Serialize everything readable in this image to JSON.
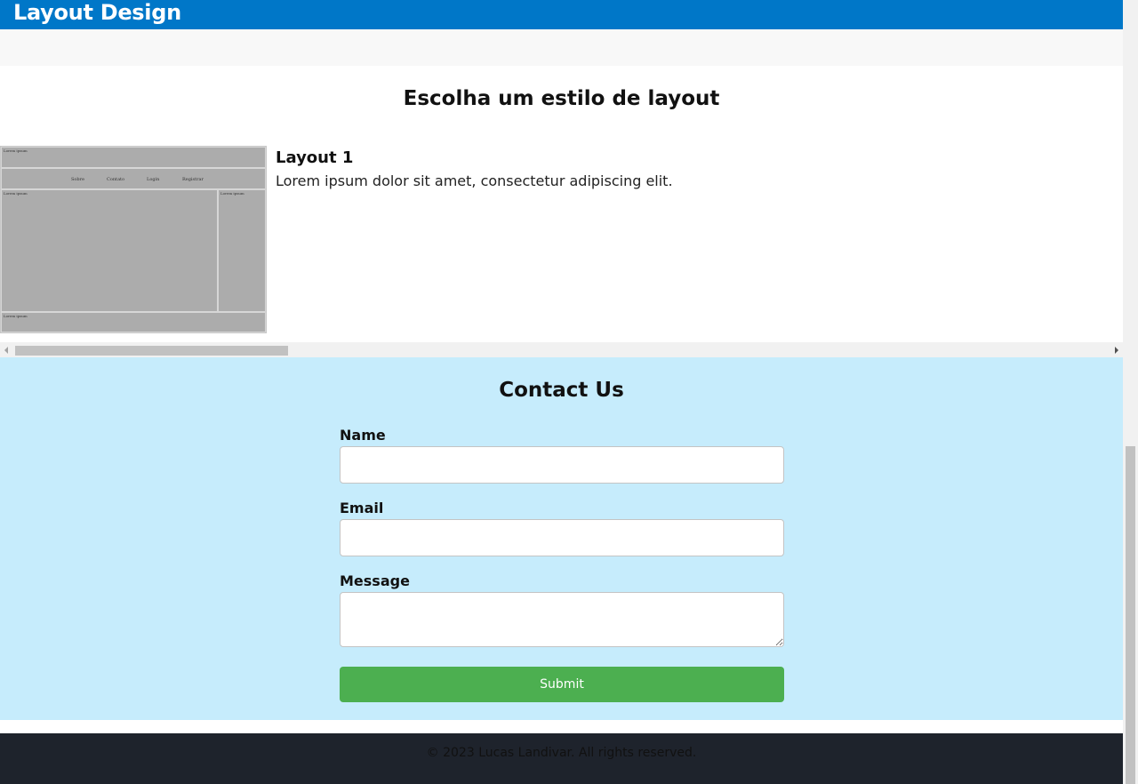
{
  "header": {
    "brand": "Layout Design"
  },
  "layouts": {
    "title": "Escolha um estilo de layout",
    "cards": [
      {
        "thumbnail": {
          "header_label": "Lorem ipsum",
          "nav": [
            "Sobre",
            "Contato",
            "Login",
            "Registrar"
          ],
          "main_label": "Lorem ipsum",
          "aside_label": "Lorem ipsum",
          "footer_label": "Lorem ipsum"
        },
        "title": "Layout 1",
        "description": "Lorem ipsum dolor sit amet, consectetur adipiscing elit."
      }
    ]
  },
  "contact": {
    "title": "Contact Us",
    "name_label": "Name",
    "name_value": "",
    "email_label": "Email",
    "email_value": "",
    "message_label": "Message",
    "message_value": "",
    "submit_label": "Submit"
  },
  "footer": {
    "copyright": "© 2023 Lucas Landivar. All rights reserved."
  },
  "colors": {
    "header_bg": "#0077c8",
    "contact_bg": "#c6ecfc",
    "submit_bg": "#4caf50",
    "footer_bg": "#1e232c"
  }
}
